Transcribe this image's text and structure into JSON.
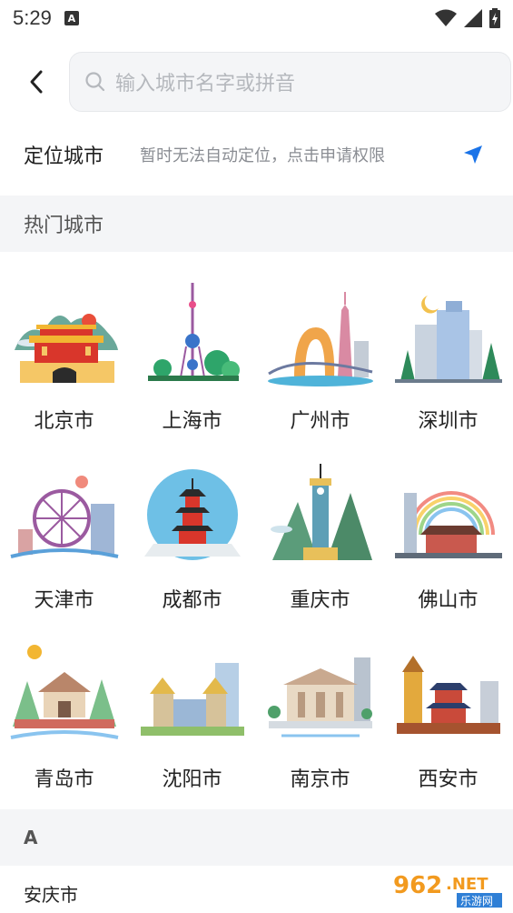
{
  "status_bar": {
    "time": "5:29",
    "notification_icon_letter": "A"
  },
  "search": {
    "placeholder": "输入城市名字或拼音"
  },
  "location": {
    "title": "定位城市",
    "message": "暂时无法自动定位，点击申请权限",
    "icon_color": "#1a73e8"
  },
  "hot_section": {
    "title": "热门城市"
  },
  "hot_cities": [
    {
      "name": "北京市",
      "icon": "beijing-tiananmen-icon"
    },
    {
      "name": "上海市",
      "icon": "shanghai-tower-icon"
    },
    {
      "name": "广州市",
      "icon": "guangzhou-tower-icon"
    },
    {
      "name": "深圳市",
      "icon": "shenzhen-skyline-icon"
    },
    {
      "name": "天津市",
      "icon": "tianjin-ferris-wheel-icon"
    },
    {
      "name": "成都市",
      "icon": "chengdu-pagoda-icon"
    },
    {
      "name": "重庆市",
      "icon": "chongqing-tower-icon"
    },
    {
      "name": "佛山市",
      "icon": "foshan-rainbow-icon"
    },
    {
      "name": "青岛市",
      "icon": "qingdao-pavilion-icon"
    },
    {
      "name": "沈阳市",
      "icon": "shenyang-palace-icon"
    },
    {
      "name": "南京市",
      "icon": "nanjing-hall-icon"
    },
    {
      "name": "西安市",
      "icon": "xian-bell-tower-icon"
    }
  ],
  "alpha_section": {
    "letter": "A"
  },
  "city_list": [
    {
      "name": "安庆市"
    }
  ],
  "watermark": {
    "number": "962",
    "domain": ".NET",
    "sub": "乐游网"
  }
}
